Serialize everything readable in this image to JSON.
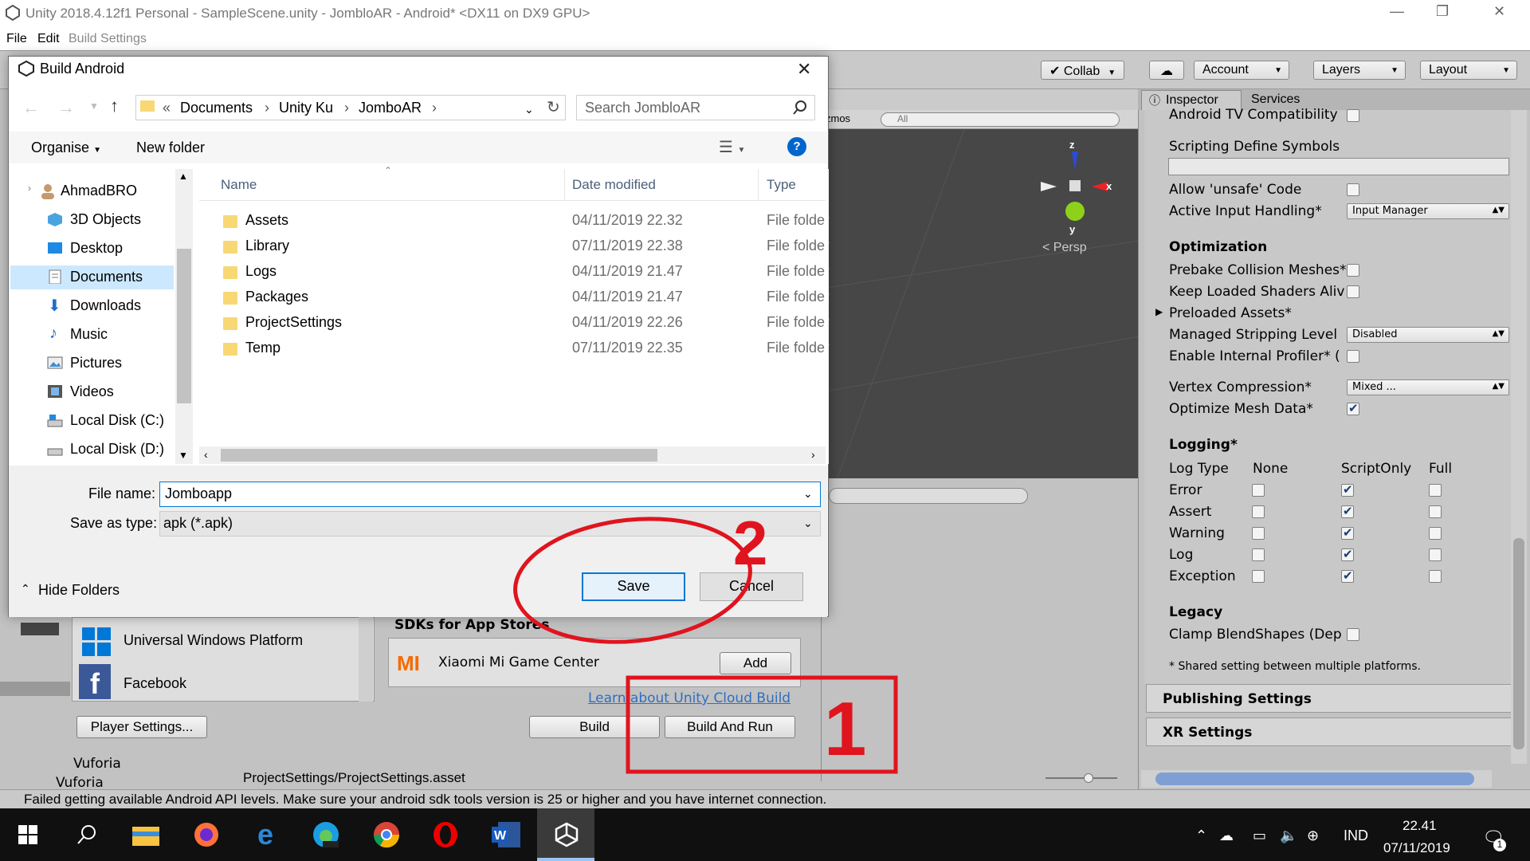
{
  "unity": {
    "title": "Unity 2018.4.12f1 Personal - SampleScene.unity - JombloAR - Android* <DX11 on DX9 GPU>",
    "menu": {
      "file": "File",
      "edit": "Edit",
      "build_settings_title": "Build Settings"
    },
    "toolbar": {
      "collab": "Collab",
      "account": "Account",
      "layers": "Layers",
      "layout": "Layout"
    },
    "scene": {
      "gizmos": "zmos",
      "search_placeholder": "All",
      "persp": "< Persp",
      "axis_x": "x",
      "axis_y": "y",
      "axis_z": "z"
    },
    "inspector": {
      "tab_inspector": "Inspector",
      "tab_services": "Services",
      "android_tv": "Android TV Compatibility",
      "scripting_define": "Scripting Define Symbols",
      "allow_unsafe": "Allow 'unsafe' Code",
      "active_input": "Active Input Handling*",
      "active_input_value": "Input Manager",
      "optimization": "Optimization",
      "prebake": "Prebake Collision Meshes*",
      "keep_loaded": "Keep Loaded Shaders Alive",
      "preloaded": "Preloaded Assets*",
      "managed_stripping": "Managed Stripping Level",
      "managed_stripping_value": "Disabled",
      "enable_profiler": "Enable Internal Profiler* (",
      "vertex_compression": "Vertex Compression*",
      "vertex_compression_value": "Mixed ...",
      "optimize_mesh": "Optimize Mesh Data*",
      "logging": "Logging*",
      "log_cols": [
        "Log Type",
        "None",
        "ScriptOnly",
        "Full"
      ],
      "log_rows": [
        "Error",
        "Assert",
        "Warning",
        "Log",
        "Exception"
      ],
      "legacy": "Legacy",
      "clamp": "Clamp BlendShapes (Dep",
      "shared_note": "* Shared setting between multiple platforms.",
      "publishing": "Publishing Settings",
      "xr": "XR Settings"
    },
    "build": {
      "platforms": [
        "Universal Windows Platform",
        "Facebook"
      ],
      "sdks_title": "SDKs for App Stores",
      "sdk_name": "Xiaomi Mi Game Center",
      "add": "Add",
      "learn": "Learn about Unity Cloud Build",
      "player_settings": "Player Settings...",
      "build": "Build",
      "build_and_run": "Build And Run"
    },
    "hierarchy": [
      "Vuforia",
      "Vuforia"
    ],
    "project_path": "ProjectSettings/ProjectSettings.asset",
    "status": "Failed getting available Android API levels. Make sure your android sdk tools version is 25 or higher and you have internet connection."
  },
  "dialog": {
    "title": "Build Android",
    "breadcrumb": [
      "Documents",
      "Unity Ku",
      "JomboAR"
    ],
    "breadcrumb_prefix": "«",
    "search_placeholder": "Search JombloAR",
    "organise": "Organise",
    "new_folder": "New folder",
    "nav": [
      "AhmadBRO",
      "3D Objects",
      "Desktop",
      "Documents",
      "Downloads",
      "Music",
      "Pictures",
      "Videos",
      "Local Disk (C:)",
      "Local Disk (D:)"
    ],
    "columns": [
      "Name",
      "Date modified",
      "Type"
    ],
    "files": [
      {
        "name": "Assets",
        "date": "04/11/2019 22.32",
        "type": "File folder"
      },
      {
        "name": "Library",
        "date": "07/11/2019 22.38",
        "type": "File folder"
      },
      {
        "name": "Logs",
        "date": "04/11/2019 21.47",
        "type": "File folder"
      },
      {
        "name": "Packages",
        "date": "04/11/2019 21.47",
        "type": "File folder"
      },
      {
        "name": "ProjectSettings",
        "date": "04/11/2019 22.26",
        "type": "File folder"
      },
      {
        "name": "Temp",
        "date": "07/11/2019 22.35",
        "type": "File folder"
      }
    ],
    "file_name_label": "File name:",
    "file_name_value": "Jomboapp",
    "save_type_label": "Save as type:",
    "save_type_value": "apk (*.apk)",
    "hide_folders": "Hide Folders",
    "save": "Save",
    "cancel": "Cancel"
  },
  "annotations": {
    "step1": "1",
    "step2": "2",
    "color": "#e0141e"
  },
  "taskbar": {
    "lang": "IND",
    "time": "22.41",
    "date": "07/11/2019",
    "notif_count": "1"
  }
}
